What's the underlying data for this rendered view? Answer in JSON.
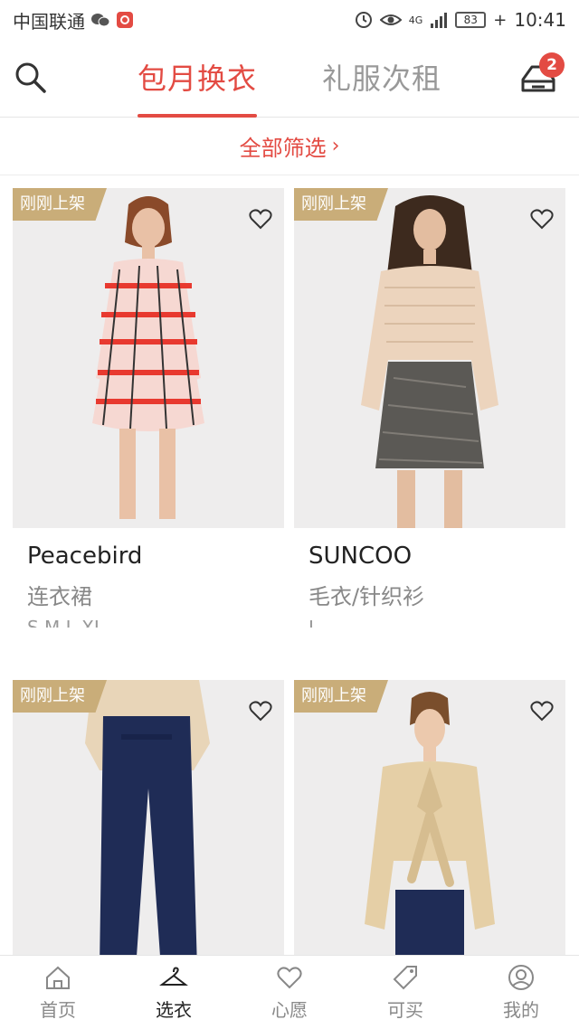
{
  "status_bar": {
    "carrier": "中国联通",
    "network": "4G",
    "battery": "83",
    "time": "10:41",
    "icons": [
      "wechat-icon",
      "app-notification-icon",
      "alarm-icon",
      "eye-icon",
      "signal-icon",
      "battery-icon"
    ]
  },
  "header": {
    "tabs": [
      {
        "label": "包月换衣",
        "active": true
      },
      {
        "label": "礼服次租",
        "active": false
      }
    ],
    "cart_count": "2",
    "icons": [
      "search-icon",
      "cart-icon"
    ]
  },
  "filter": {
    "label": "全部筛选",
    "chevron": "›"
  },
  "products": [
    {
      "badge": "刚刚上架",
      "brand": "Peacebird",
      "category": "连衣裙",
      "sizes": "S M L XL"
    },
    {
      "badge": "刚刚上架",
      "brand": "SUNCOO",
      "category": "毛衣/针织衫",
      "sizes": "L"
    },
    {
      "badge": "刚刚上架",
      "brand": "",
      "category": "",
      "sizes": ""
    },
    {
      "badge": "刚刚上架",
      "brand": "",
      "category": "",
      "sizes": ""
    }
  ],
  "bottom_nav": [
    {
      "label": "首页",
      "icon": "home-icon",
      "active": false
    },
    {
      "label": "选衣",
      "icon": "hanger-icon",
      "active": true
    },
    {
      "label": "心愿",
      "icon": "heart-icon",
      "active": false
    },
    {
      "label": "可买",
      "icon": "tag-icon",
      "active": false
    },
    {
      "label": "我的",
      "icon": "profile-icon",
      "active": false
    }
  ],
  "colors": {
    "accent": "#e34b43",
    "badge": "#c9ad79",
    "photo_bg": "#eeeded"
  }
}
